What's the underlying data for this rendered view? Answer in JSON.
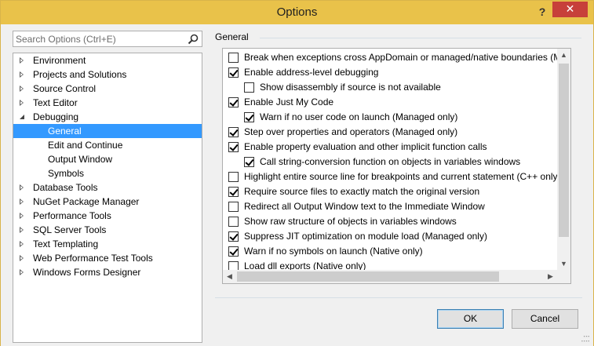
{
  "window": {
    "title": "Options",
    "help_label": "?",
    "close_label": "✕"
  },
  "search": {
    "placeholder": "Search Options (Ctrl+E)"
  },
  "tree": {
    "items": [
      {
        "label": "Environment",
        "level": 0,
        "state": "collapsed"
      },
      {
        "label": "Projects and Solutions",
        "level": 0,
        "state": "collapsed"
      },
      {
        "label": "Source Control",
        "level": 0,
        "state": "collapsed"
      },
      {
        "label": "Text Editor",
        "level": 0,
        "state": "collapsed"
      },
      {
        "label": "Debugging",
        "level": 0,
        "state": "expanded"
      },
      {
        "label": "General",
        "level": 1,
        "state": "leaf",
        "selected": true
      },
      {
        "label": "Edit and Continue",
        "level": 1,
        "state": "leaf"
      },
      {
        "label": "Output Window",
        "level": 1,
        "state": "leaf"
      },
      {
        "label": "Symbols",
        "level": 1,
        "state": "leaf"
      },
      {
        "label": "Database Tools",
        "level": 0,
        "state": "collapsed"
      },
      {
        "label": "NuGet Package Manager",
        "level": 0,
        "state": "collapsed"
      },
      {
        "label": "Performance Tools",
        "level": 0,
        "state": "collapsed"
      },
      {
        "label": "SQL Server Tools",
        "level": 0,
        "state": "collapsed"
      },
      {
        "label": "Text Templating",
        "level": 0,
        "state": "collapsed"
      },
      {
        "label": "Web Performance Test Tools",
        "level": 0,
        "state": "collapsed"
      },
      {
        "label": "Windows Forms Designer",
        "level": 0,
        "state": "collapsed"
      }
    ]
  },
  "general": {
    "group_label": "General",
    "options": [
      {
        "label": "Break when exceptions cross AppDomain or managed/native boundaries (Managed only)",
        "checked": false,
        "indent": 0
      },
      {
        "label": "Enable address-level debugging",
        "checked": true,
        "indent": 0
      },
      {
        "label": "Show disassembly if source is not available",
        "checked": false,
        "indent": 1
      },
      {
        "label": "Enable Just My Code",
        "checked": true,
        "indent": 0
      },
      {
        "label": "Warn if no user code on launch (Managed only)",
        "checked": true,
        "indent": 1
      },
      {
        "label": "Step over properties and operators (Managed only)",
        "checked": true,
        "indent": 0
      },
      {
        "label": "Enable property evaluation and other implicit function calls",
        "checked": true,
        "indent": 0
      },
      {
        "label": "Call string-conversion function on objects in variables windows",
        "checked": true,
        "indent": 1
      },
      {
        "label": "Highlight entire source line for breakpoints and current statement (C++ only)",
        "checked": false,
        "indent": 0
      },
      {
        "label": "Require source files to exactly match the original version",
        "checked": true,
        "indent": 0
      },
      {
        "label": "Redirect all Output Window text to the Immediate Window",
        "checked": false,
        "indent": 0
      },
      {
        "label": "Show raw structure of objects in variables windows",
        "checked": false,
        "indent": 0
      },
      {
        "label": "Suppress JIT optimization on module load (Managed only)",
        "checked": true,
        "indent": 0
      },
      {
        "label": "Warn if no symbols on launch (Native only)",
        "checked": true,
        "indent": 0
      },
      {
        "label": "Load dll exports (Native only)",
        "checked": false,
        "indent": 0
      }
    ]
  },
  "buttons": {
    "ok": "OK",
    "cancel": "Cancel"
  }
}
